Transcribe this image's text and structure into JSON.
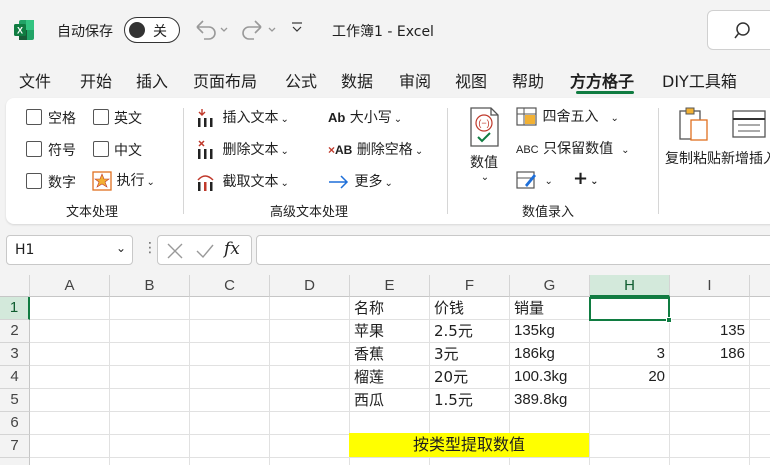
{
  "titlebar": {
    "autosave_label": "自动保存",
    "autosave_state": "关",
    "doc_title": "工作簿1  -  Excel"
  },
  "tabs": [
    "文件",
    "开始",
    "插入",
    "页面布局",
    "公式",
    "数据",
    "审阅",
    "视图",
    "帮助",
    "方方格子",
    "DIY工具箱"
  ],
  "active_tab": "方方格子",
  "ribbon": {
    "text_group": {
      "label": "文本处理",
      "checkboxes": [
        "空格",
        "英文",
        "符号",
        "中文",
        "数字"
      ],
      "exec": "执行"
    },
    "adv_group": {
      "label": "高级文本处理",
      "items": [
        "插入文本",
        "删除文本",
        "截取文本",
        "大小写",
        "删除空格",
        "更多"
      ]
    },
    "num_group": {
      "label": "数值录入",
      "value_btn": "数值",
      "round_btn": "四舍五入",
      "keep_btn": "只保留数值"
    },
    "copy_paste": "复制粘贴",
    "add_insert": "新增插入"
  },
  "formula_bar": {
    "name_box": "H1",
    "fx": "fx",
    "formula": ""
  },
  "grid": {
    "columns": [
      "A",
      "B",
      "C",
      "D",
      "E",
      "F",
      "G",
      "H",
      "I"
    ],
    "selected_column": "H",
    "rows": [
      "1",
      "2",
      "3",
      "4",
      "5",
      "6",
      "7"
    ],
    "selected_row": "1",
    "cells": {
      "E1": "名称",
      "F1": "价钱",
      "G1": "销量",
      "E2": "苹果",
      "F2": "2.5元",
      "G2": "135kg",
      "I2": "135",
      "E3": "香蕉",
      "F3": "3元",
      "G3": "186kg",
      "H3": "3",
      "I3": "186",
      "E4": "榴莲",
      "F4": "20元",
      "G4": "100.3kg",
      "H4": "20",
      "E5": "西瓜",
      "F5": "1.5元",
      "G5": "389.8kg"
    },
    "banner_text": "按类型提取数值",
    "banner_color": "#ffff00"
  },
  "colors": {
    "accent": "#107c41",
    "brand": "#107c41"
  }
}
